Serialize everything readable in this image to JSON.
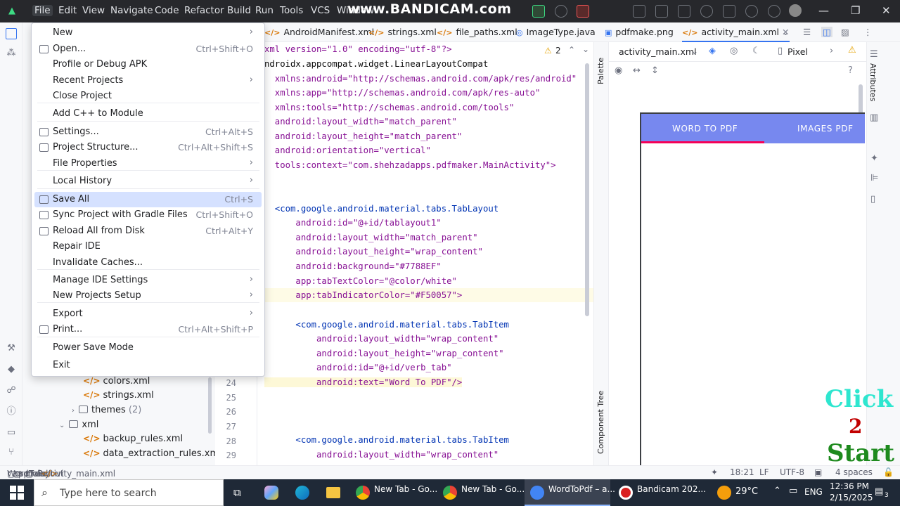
{
  "titlebar": {
    "menus": [
      "File",
      "Edit",
      "View",
      "Navigate",
      "Code",
      "Refactor",
      "Build",
      "Run",
      "Tools",
      "VCS",
      "Window"
    ],
    "watermark": "www.BANDICAM.com"
  },
  "file_menu": {
    "items": [
      {
        "label": "New",
        "shortcut": "",
        "submenu": true
      },
      {
        "label": "Open...",
        "shortcut": "Ctrl+Shift+O",
        "icon": "folder-icon"
      },
      {
        "label": "Profile or Debug APK",
        "shortcut": ""
      },
      {
        "label": "Recent Projects",
        "shortcut": "",
        "submenu": true
      },
      {
        "label": "Close Project",
        "shortcut": ""
      },
      {
        "label": "Add C++ to Module",
        "shortcut": ""
      },
      {
        "label": "Settings...",
        "shortcut": "Ctrl+Alt+S",
        "icon": "gear-icon"
      },
      {
        "label": "Project Structure...",
        "shortcut": "Ctrl+Alt+Shift+S",
        "icon": "project-structure-icon"
      },
      {
        "label": "File Properties",
        "shortcut": "",
        "submenu": true
      },
      {
        "label": "Local History",
        "shortcut": "",
        "submenu": true
      },
      {
        "label": "Save All",
        "shortcut": "Ctrl+S",
        "icon": "save-icon",
        "selected": true
      },
      {
        "label": "Sync Project with Gradle Files",
        "shortcut": "Ctrl+Shift+O",
        "icon": "gradle-sync-icon"
      },
      {
        "label": "Reload All from Disk",
        "shortcut": "Ctrl+Alt+Y",
        "icon": "reload-icon"
      },
      {
        "label": "Repair IDE",
        "shortcut": ""
      },
      {
        "label": "Invalidate Caches...",
        "shortcut": ""
      },
      {
        "label": "Manage IDE Settings",
        "shortcut": "",
        "submenu": true
      },
      {
        "label": "New Projects Setup",
        "shortcut": "",
        "submenu": true
      },
      {
        "label": "Export",
        "shortcut": "",
        "submenu": true
      },
      {
        "label": "Print...",
        "shortcut": "Ctrl+Alt+Shift+P",
        "icon": "print-icon"
      },
      {
        "label": "Power Save Mode",
        "shortcut": ""
      },
      {
        "label": "Exit",
        "shortcut": ""
      }
    ]
  },
  "tabs": [
    "AndroidManifest.xml",
    "strings.xml",
    "file_paths.xml",
    "ImageType.java",
    "pdfmake.png",
    "activity_main.xml"
  ],
  "project_tree": [
    {
      "label": "colors.xml",
      "type": "xml"
    },
    {
      "label": "strings.xml",
      "type": "xml"
    },
    {
      "label": "themes",
      "count": "(2)",
      "type": "folder"
    },
    {
      "label": "xml",
      "type": "folder-open"
    },
    {
      "label": "backup_rules.xml",
      "type": "xml"
    },
    {
      "label": "data_extraction_rules.xml",
      "type": "xml"
    }
  ],
  "line_numbers": [
    "24",
    "25",
    "26",
    "27",
    "28",
    "29"
  ],
  "code_lines": [
    "xml version=\"1.0\" encoding=\"utf-8\"?>",
    "ndroidx.appcompat.widget.LinearLayoutCompat",
    "  xmlns:android=\"http://schemas.android.com/apk/res/android\"",
    "  xmlns:app=\"http://schemas.android.com/apk/res-auto\"",
    "  xmlns:tools=\"http://schemas.android.com/tools\"",
    "  android:layout_width=\"match_parent\"",
    "  android:layout_height=\"match_parent\"",
    "  android:orientation=\"vertical\"",
    "  tools:context=\"com.shehzadapps.pdfmaker.MainActivity\">",
    "",
    "",
    "  <com.google.android.material.tabs.TabLayout",
    "      android:id=\"@+id/tablayout1\"",
    "      android:layout_width=\"match_parent\"",
    "      android:layout_height=\"wrap_content\"",
    "      android:background=\"#7788EF\"",
    "      app:tabTextColor=\"@color/white\"",
    "      app:tabIndicatorColor=\"#F50057\">",
    "",
    "      <com.google.android.material.tabs.TabItem",
    "          android:layout_width=\"wrap_content\"",
    "          android:layout_height=\"wrap_content\"",
    "          android:id=\"@+id/verb_tab\"",
    "          android:text=\"Word To PDF\"/>",
    "",
    "",
    "",
    "      <com.google.android.material.tabs.TabItem",
    "          android:layout_width=\"wrap_content\""
  ],
  "inspection": {
    "count": "2"
  },
  "design": {
    "file": "activity_main.xml",
    "device": "Pixel",
    "palette_label": "Palette",
    "component_tree_label": "Component Tree",
    "attributes_label": "Attributes",
    "tab1": "WORD TO PDF",
    "tab2": "IMAGES PDF",
    "bar_color": "#7788EF",
    "indicator_color": "#F50057"
  },
  "overlay": {
    "click": "Click",
    "number": "2",
    "start": "Start"
  },
  "statusbar": {
    "breadcrumbs": [
      "WordToPdf",
      "app",
      "src",
      "main",
      "res",
      "layout",
      "activity_main.xml"
    ],
    "position": "18:21",
    "line_sep": "LF",
    "encoding": "UTF-8",
    "indent": "4 spaces"
  },
  "taskbar": {
    "search_placeholder": "Type here to search",
    "apps": [
      {
        "label": "New Tab - Go...",
        "icon": "chrome-icon"
      },
      {
        "label": "New Tab - Go...",
        "icon": "chrome-icon"
      },
      {
        "label": "WordToPdf – a...",
        "icon": "android-studio-icon",
        "active": true
      },
      {
        "label": "Bandicam 202...",
        "icon": "bandicam-icon"
      }
    ],
    "weather": "29°C",
    "language": "ENG",
    "time": "12:36 PM",
    "date": "2/15/2025",
    "notifications": "3"
  }
}
